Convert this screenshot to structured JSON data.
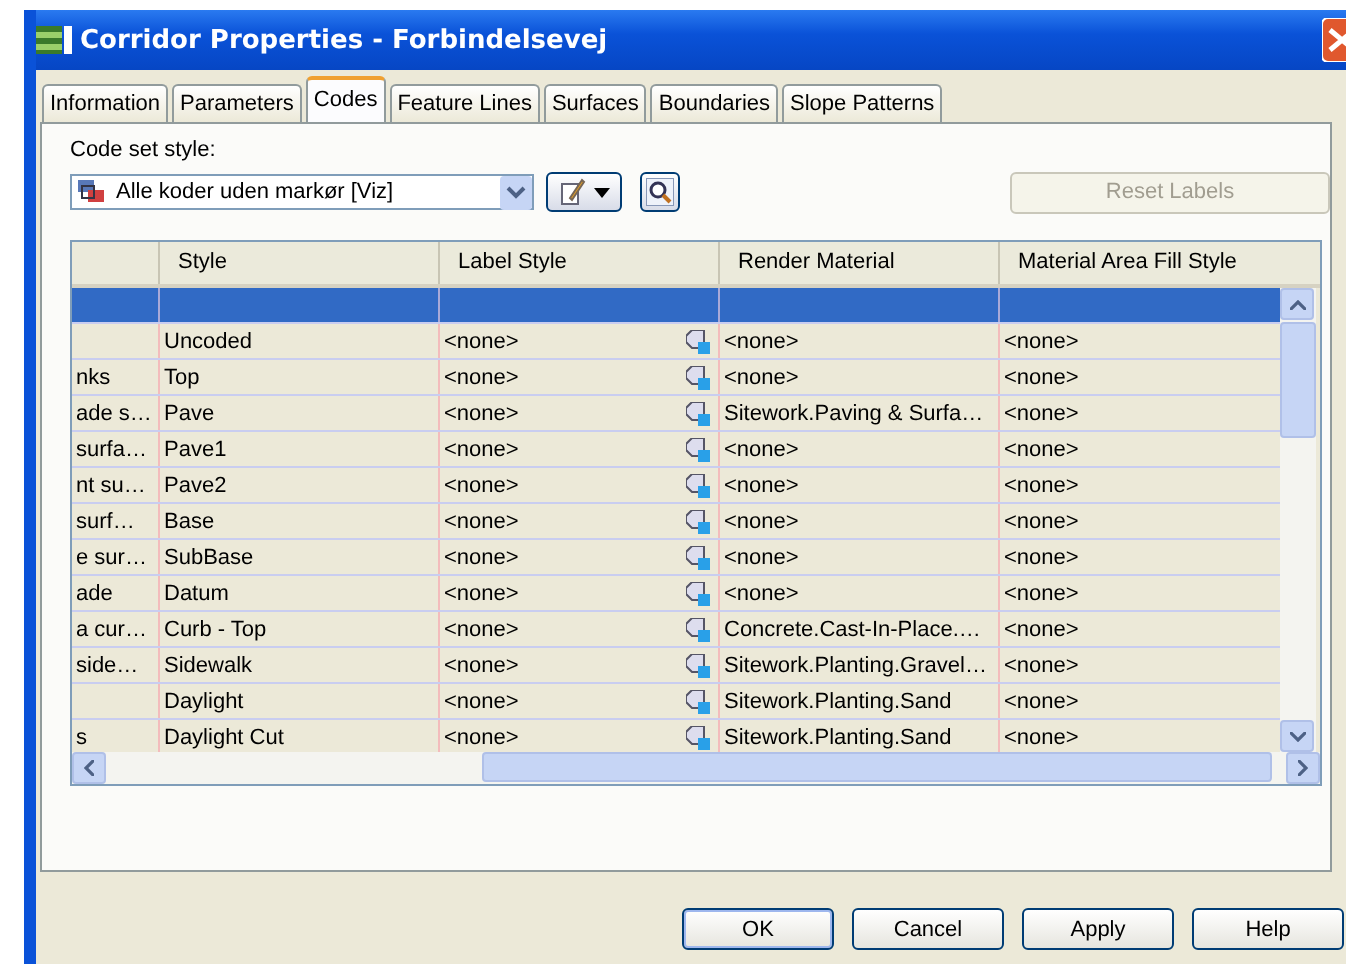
{
  "window": {
    "title": "Corridor Properties - Forbindelsevej"
  },
  "tabs": [
    {
      "label": "Information",
      "selected": false
    },
    {
      "label": "Parameters",
      "selected": false
    },
    {
      "label": "Codes",
      "selected": true
    },
    {
      "label": "Feature Lines",
      "selected": false
    },
    {
      "label": "Surfaces",
      "selected": false
    },
    {
      "label": "Boundaries",
      "selected": false
    },
    {
      "label": "Slope Patterns",
      "selected": false
    }
  ],
  "code_set_style": {
    "label": "Code set style:",
    "value": "Alle koder uden markør [Viz]"
  },
  "reset_button": {
    "label": "Reset Labels",
    "disabled": true
  },
  "table": {
    "columns": [
      "",
      "Style",
      "Label Style",
      "Render Material",
      "Material Area Fill Style"
    ],
    "rows": [
      {
        "cells": [
          "",
          "",
          "",
          "",
          ""
        ],
        "selected": true
      },
      {
        "cells": [
          "",
          "Uncoded",
          "<none>",
          "<none>",
          "<none>"
        ],
        "selected": false
      },
      {
        "cells": [
          "nks",
          "Top",
          "<none>",
          "<none>",
          "<none>"
        ],
        "selected": false
      },
      {
        "cells": [
          "ade s…",
          "Pave",
          "<none>",
          "Sitework.Paving & Surfa…",
          "<none>"
        ],
        "selected": false
      },
      {
        "cells": [
          "surfa…",
          "Pave1",
          "<none>",
          "<none>",
          "<none>"
        ],
        "selected": false
      },
      {
        "cells": [
          "nt su…",
          "Pave2",
          "<none>",
          "<none>",
          "<none>"
        ],
        "selected": false
      },
      {
        "cells": [
          "surf…",
          "Base",
          "<none>",
          "<none>",
          "<none>"
        ],
        "selected": false
      },
      {
        "cells": [
          "e sur…",
          "SubBase",
          "<none>",
          "<none>",
          "<none>"
        ],
        "selected": false
      },
      {
        "cells": [
          "ade",
          "Datum",
          "<none>",
          "<none>",
          "<none>"
        ],
        "selected": false
      },
      {
        "cells": [
          "a cur…",
          "Curb - Top",
          "<none>",
          "Concrete.Cast-In-Place.…",
          "<none>"
        ],
        "selected": false
      },
      {
        "cells": [
          "side…",
          "Sidewalk",
          "<none>",
          "Sitework.Planting.Gravel…",
          "<none>"
        ],
        "selected": false
      },
      {
        "cells": [
          "",
          "Daylight",
          "<none>",
          "Sitework.Planting.Sand",
          "<none>"
        ],
        "selected": false
      },
      {
        "cells": [
          "s",
          "Daylight Cut",
          "<none>",
          "Sitework.Planting.Sand",
          "<none>"
        ],
        "selected": false
      }
    ]
  },
  "buttons": [
    {
      "label": "OK",
      "default": true
    },
    {
      "label": "Cancel",
      "default": false
    },
    {
      "label": "Apply",
      "default": false
    },
    {
      "label": "Help",
      "default": false
    }
  ]
}
